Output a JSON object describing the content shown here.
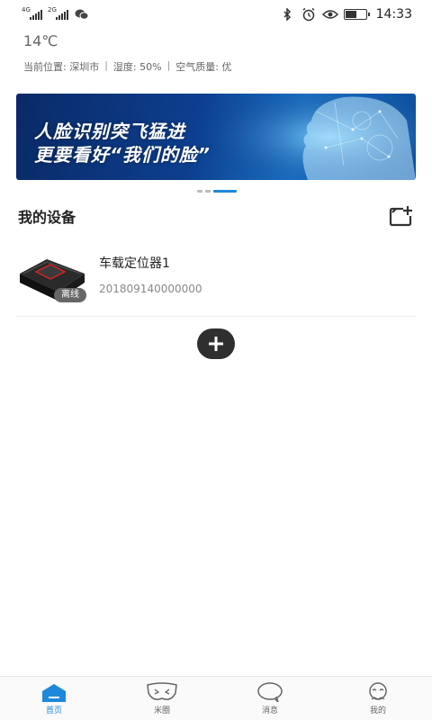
{
  "status_bar": {
    "net1": "4G",
    "net2": "2G",
    "time": "14:33",
    "battery_level": 0.55,
    "icons": [
      "signal-icon",
      "signal-icon",
      "wechat-icon",
      "bluetooth-icon",
      "alarm-icon",
      "eye-icon",
      "battery-icon"
    ]
  },
  "weather": {
    "temperature": "14℃",
    "location": "当前位置: 深圳市",
    "humidity": "湿度: 50%",
    "air_quality": "空气质量: 优",
    "separator": "|"
  },
  "banner": {
    "line1": "人脸识别突飞猛进",
    "line2": "更要看好“我们的脸”",
    "page_count": 3,
    "active_page": 3
  },
  "devices_section": {
    "title": "我的设备",
    "add_icon": "add-device-icon",
    "devices": [
      {
        "name": "车载定位器1",
        "id": "201809140000000",
        "status": "离线"
      }
    ],
    "add_button_icon": "plus-icon"
  },
  "bottom_nav": {
    "active": "home",
    "accent": "#1e88d9",
    "items": [
      {
        "label": "首页",
        "icon": "home-icon"
      },
      {
        "label": "米圈",
        "icon": "mask-icon"
      },
      {
        "label": "消息",
        "icon": "chat-bubble-icon"
      },
      {
        "label": "我的",
        "icon": "profile-icon"
      }
    ]
  }
}
